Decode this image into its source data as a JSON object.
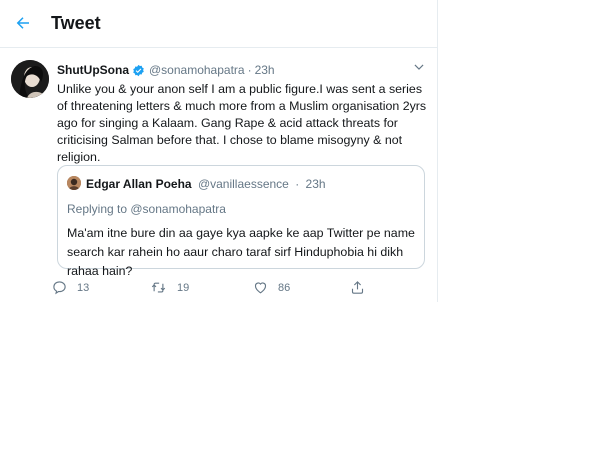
{
  "header": {
    "title": "Tweet"
  },
  "tweet": {
    "display_name": "ShutUpSona",
    "handle": "@sonamohapatra",
    "separator": "·",
    "time": "23h",
    "text": "Unlike you & your anon self I am a public figure.I was sent a series of threatening letters & much more from a Muslim organisation 2yrs ago for singing a Kalaam. Gang Rape & acid attack threats for criticising Salman before that. I chose to blame misogyny & not religion."
  },
  "quote": {
    "display_name": "Edgar Allan Poeha",
    "handle": "@vanillaessence",
    "separator": "·",
    "time": "23h",
    "replying_to": "Replying to @sonamohapatra",
    "text": "Ma'am itne bure din aa gaye kya aapke ke  aap Twitter pe name search kar rahein ho aaur charo taraf sirf Hinduphobia hi dikh rahaa hain?"
  },
  "actions": {
    "reply_count": "13",
    "retweet_count": "19",
    "like_count": "86"
  },
  "colors": {
    "accent": "#1da1f2",
    "secondary_text": "#657786",
    "border": "#e6ecf0"
  },
  "icons": {
    "back": "arrow-left-icon",
    "verified": "verified-badge-icon",
    "caret": "chevron-down-icon",
    "reply": "reply-icon",
    "retweet": "retweet-icon",
    "like": "heart-icon",
    "share": "share-icon"
  }
}
